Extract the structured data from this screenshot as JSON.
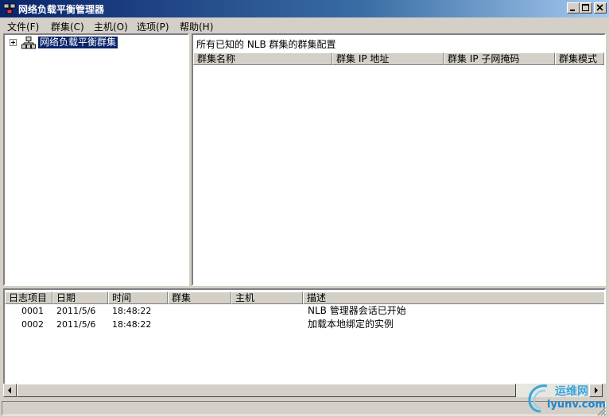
{
  "window": {
    "title": "网络负载平衡管理器"
  },
  "menubar": {
    "items": [
      {
        "label": "文件(F)"
      },
      {
        "label": "群集(C)"
      },
      {
        "label": "主机(O)"
      },
      {
        "label": "选项(P)"
      },
      {
        "label": "帮助(H)"
      }
    ]
  },
  "tree": {
    "root_label": "网络负载平衡群集"
  },
  "clusters_pane": {
    "caption": "所有已知的 NLB 群集的群集配置",
    "columns": [
      "群集名称",
      "群集 IP 地址",
      "群集 IP 子网掩码",
      "群集模式"
    ]
  },
  "log_pane": {
    "columns": [
      "日志项目",
      "日期",
      "时间",
      "群集",
      "主机",
      "描述"
    ],
    "rows": [
      {
        "entry": "0001",
        "date": "2011/5/6",
        "time": "18:48:22",
        "cluster": "",
        "host": "",
        "desc": "NLB 管理器会话已开始"
      },
      {
        "entry": "0002",
        "date": "2011/5/6",
        "time": "18:48:22",
        "cluster": "",
        "host": "",
        "desc": "加载本地绑定的实例"
      }
    ]
  },
  "watermark": {
    "brand": "运维网",
    "site": "iyunv.com"
  }
}
